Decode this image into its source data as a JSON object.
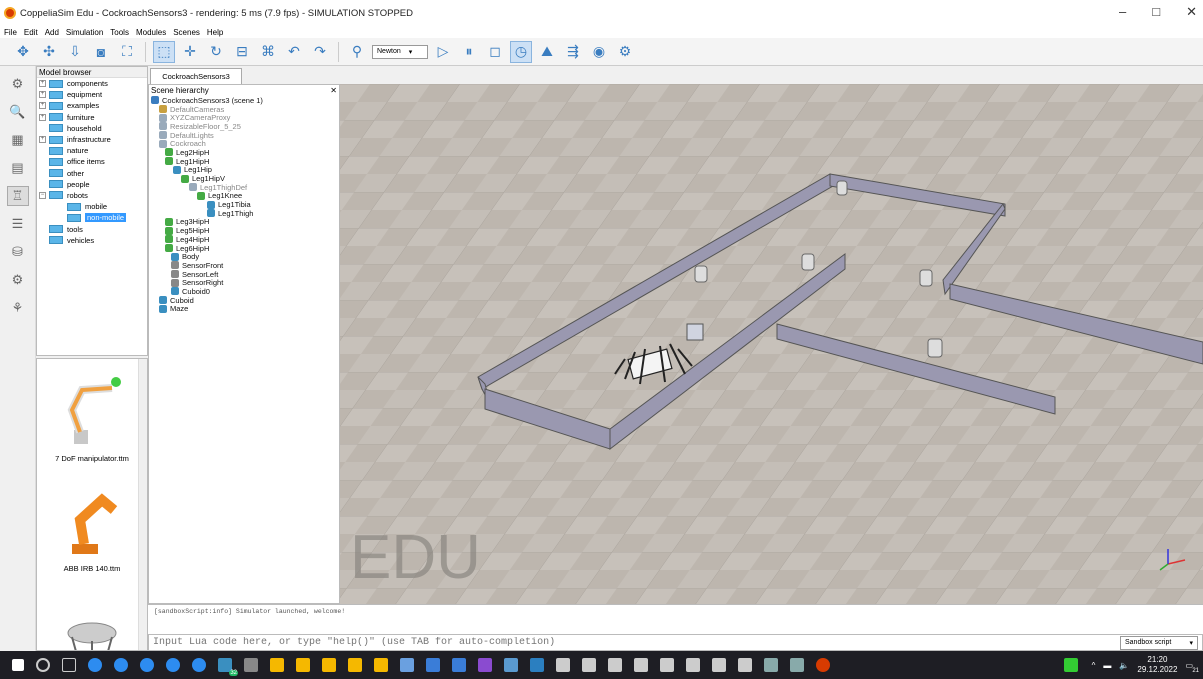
{
  "window": {
    "title": "CoppeliaSim Edu - CockroachSensors3 - rendering: 5 ms (7.9 fps) - SIMULATION STOPPED",
    "minimize": "–",
    "maximize": "□",
    "close": "✕"
  },
  "menu": [
    "File",
    "Edit",
    "Add",
    "Simulation",
    "Tools",
    "Modules",
    "Scenes",
    "Help"
  ],
  "toolbar": {
    "engine": "Newton"
  },
  "model_browser": {
    "title": "Model browser",
    "items": [
      {
        "label": "components",
        "expander": "+"
      },
      {
        "label": "equipment",
        "expander": "+"
      },
      {
        "label": "examples",
        "expander": "+"
      },
      {
        "label": "furniture",
        "expander": "+"
      },
      {
        "label": "household",
        "expander": ""
      },
      {
        "label": "infrastructure",
        "expander": "+"
      },
      {
        "label": "nature",
        "expander": ""
      },
      {
        "label": "office items",
        "expander": ""
      },
      {
        "label": "other",
        "expander": ""
      },
      {
        "label": "people",
        "expander": ""
      },
      {
        "label": "robots",
        "expander": "−"
      },
      {
        "label": "mobile",
        "expander": ""
      },
      {
        "label": "non-mobile",
        "expander": ""
      },
      {
        "label": "tools",
        "expander": ""
      },
      {
        "label": "vehicles",
        "expander": ""
      }
    ],
    "thumbs": [
      "7 DoF manipulator.ttm",
      "ABB IRB 140.ttm"
    ]
  },
  "tabs": {
    "scene": "CockroachSensors3"
  },
  "hierarchy": {
    "title": "Scene hierarchy",
    "close": "✕",
    "items": [
      {
        "label": "CockroachSensors3 (scene 1)",
        "color": "#3a7dc0"
      },
      {
        "label": "DefaultCameras",
        "color": "#c8a040"
      },
      {
        "label": "XYZCameraProxy",
        "color": "#9ab"
      },
      {
        "label": "ResizableFloor_5_25",
        "color": "#9ab"
      },
      {
        "label": "DefaultLights",
        "color": "#9ab"
      },
      {
        "label": "Cockroach",
        "color": "#9ab"
      },
      {
        "label": "Leg2HipH",
        "color": "#4a4"
      },
      {
        "label": "Leg1HipH",
        "color": "#4a4"
      },
      {
        "label": "Leg1Hip",
        "color": "#3a8fc0"
      },
      {
        "label": "Leg1HipV",
        "color": "#4a4"
      },
      {
        "label": "Leg1ThighDef",
        "color": "#9ab"
      },
      {
        "label": "Leg1Knee",
        "color": "#4a4"
      },
      {
        "label": "Leg1Tibia",
        "color": "#3a8fc0"
      },
      {
        "label": "Leg1Thigh",
        "color": "#3a8fc0"
      },
      {
        "label": "Leg3HipH",
        "color": "#4a4"
      },
      {
        "label": "Leg5HipH",
        "color": "#4a4"
      },
      {
        "label": "Leg4HipH",
        "color": "#4a4"
      },
      {
        "label": "Leg6HipH",
        "color": "#4a4"
      },
      {
        "label": "Body",
        "color": "#3a8fc0"
      },
      {
        "label": "SensorFront",
        "color": "#888"
      },
      {
        "label": "SensorLeft",
        "color": "#888"
      },
      {
        "label": "SensorRight",
        "color": "#888"
      },
      {
        "label": "Cuboid0",
        "color": "#3a8fc0"
      },
      {
        "label": "Cuboid",
        "color": "#3a8fc0"
      },
      {
        "label": "Maze",
        "color": "#3a8fc0"
      }
    ]
  },
  "viewport": {
    "watermark": "EDU"
  },
  "console": {
    "log": "[sandboxScript:info] Simulator launched, welcome!",
    "input_placeholder": "Input Lua code here, or type \"help()\" (use TAB for auto-completion)",
    "script_select": "Sandbox script"
  },
  "taskbar": {
    "time": "21:20",
    "date": "29.12.2022",
    "badge": "32",
    "notif": "21"
  }
}
